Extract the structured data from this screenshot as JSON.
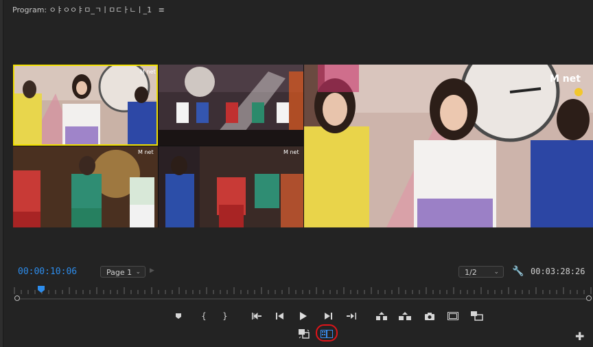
{
  "panel": {
    "title": "Program: ㅇㅑㅇㅇㅑㅁ_ㄱㅣㅁㄷㅏㄴㅣ_1",
    "menu_icon": "hamburger-menu-icon"
  },
  "monitor": {
    "layout": "multi-camera",
    "active_camera": 1,
    "active_border_color": "#f2e000"
  },
  "transport": {
    "current_timecode": "00:00:10:06",
    "duration_timecode": "00:03:28:26",
    "page_select": {
      "value": "Page 1"
    },
    "resolution_select": {
      "value": "1/2"
    },
    "playhead_color": "#2d8ceb",
    "timecode_color": "#2d8ceb"
  },
  "buttons": {
    "row1": [
      "add-marker-icon",
      "mark-in-icon",
      "mark-out-icon",
      "go-to-in-icon",
      "step-back-icon",
      "play-icon",
      "step-forward-icon",
      "go-to-out-icon",
      "lift-icon",
      "extract-icon",
      "export-frame-icon",
      "safe-margins-icon",
      "comparison-view-icon"
    ],
    "row2": [
      "toggle-proxies-icon",
      "multicam-view-icon"
    ]
  },
  "annotation": {
    "highlight_color": "#e0141a"
  }
}
